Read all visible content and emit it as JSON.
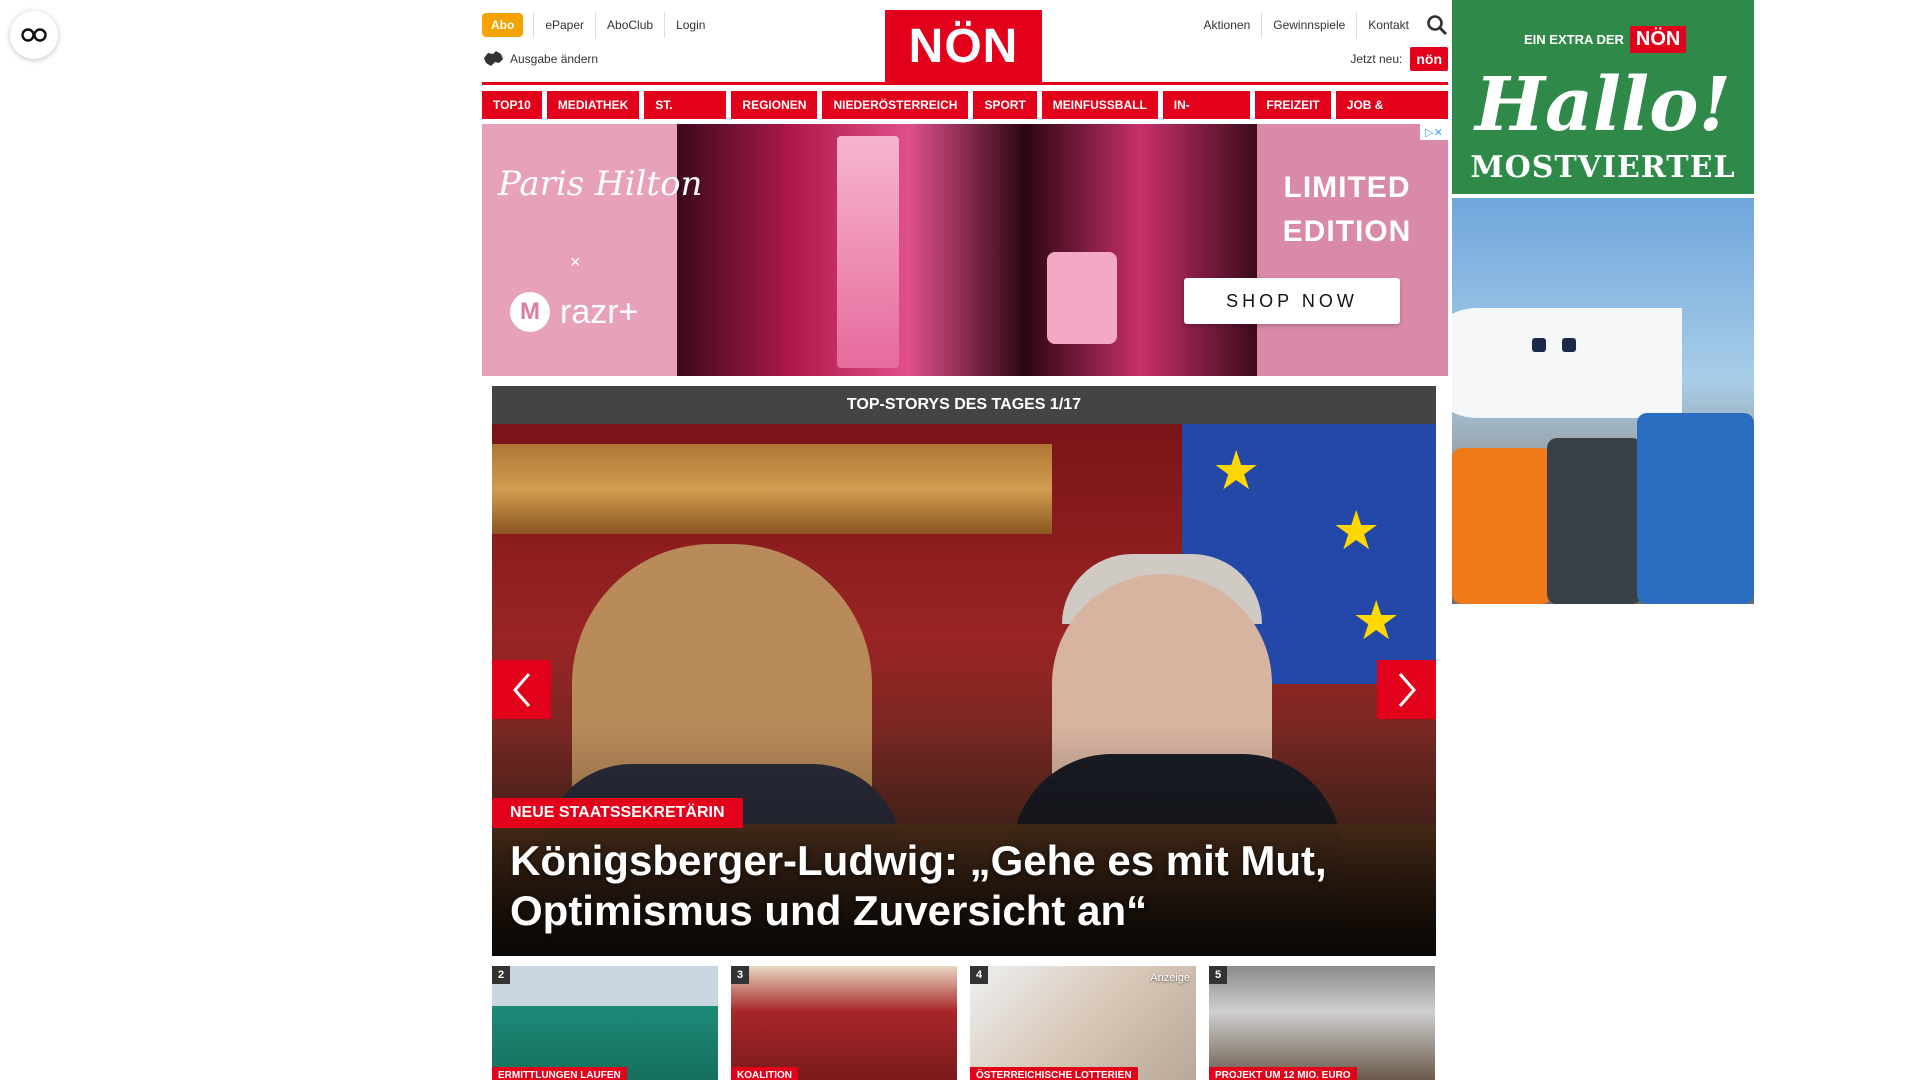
{
  "header": {
    "abo_label": "Abo",
    "util_links": [
      "ePaper",
      "AboClub",
      "Login"
    ],
    "edition_label": "Ausgabe ändern",
    "logo_text": "NÖN",
    "right_links": [
      "Aktionen",
      "Gewinnspiele",
      "Kontakt"
    ],
    "jetzt_neu_label": "Jetzt neu:",
    "jetzt_neu_badge": "nön",
    "brand_color": "#e2001a"
  },
  "mainnav": [
    "TOP10",
    "MEDIATHEK",
    "ST. PÖLTEN",
    "REGIONEN",
    "NIEDERÖSTERREICH",
    "SPORT",
    "MEINFUSSBALL",
    "IN-AUSLAND",
    "FREIZEIT",
    "JOB & KARRIERE"
  ],
  "banner_ad": {
    "brand_left": "Paris Hilton",
    "times": "×",
    "partner": "razr+",
    "headline": "LIMITED EDITION",
    "cta": "SHOP NOW"
  },
  "top_stories": {
    "header": "TOP-STORYS DES TAGES 1/17",
    "hero": {
      "kicker": "NEUE STAATSSEKRETÄRIN",
      "headline": "Königsberger-Ludwig: „Gehe es mit Mut, Optimismus und Zuversicht an“"
    },
    "thumbnails": [
      {
        "num": "2",
        "tag": "ERMITTLUNGEN LAUFEN",
        "anzeige": ""
      },
      {
        "num": "3",
        "tag": "KOALITION",
        "anzeige": ""
      },
      {
        "num": "4",
        "tag": "ÖSTERREICHISCHE LOTTERIEN",
        "anzeige": "Anzeige"
      },
      {
        "num": "5",
        "tag": "PROJEKT UM 12 MIO. EURO",
        "anzeige": ""
      }
    ]
  },
  "side_ad": {
    "extra": "EIN EXTRA DER",
    "extra_brand": "NÖN",
    "big": "Hallo!",
    "sub": "MOSTVIERTEL"
  }
}
